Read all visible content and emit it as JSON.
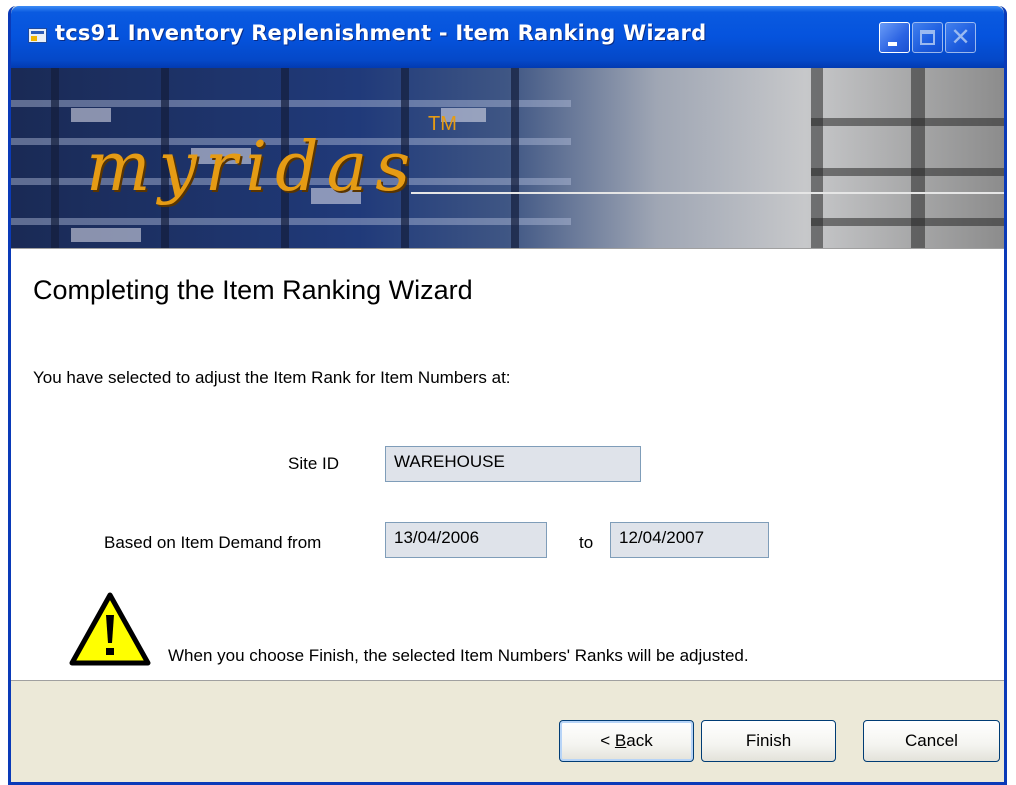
{
  "window": {
    "title": "tcs91 Inventory Replenishment - Item Ranking Wizard"
  },
  "banner": {
    "logo_text": "myridas",
    "trademark": "TM"
  },
  "content": {
    "heading": "Completing the Item Ranking Wizard",
    "intro": "You have selected to adjust the Item Rank for Item Numbers at:",
    "site_id_label": "Site ID",
    "site_id_value": "WAREHOUSE",
    "demand_label": "Based on Item Demand from",
    "from_date": "13/04/2006",
    "to_label": "to",
    "to_date": "12/04/2007",
    "warning_text": "When you choose Finish, the selected Item Numbers' Ranks will be adjusted."
  },
  "buttons": {
    "back_prefix": "< ",
    "back_mnemonic": "B",
    "back_rest": "ack",
    "finish": "Finish",
    "cancel": "Cancel"
  },
  "colors": {
    "titlebar": "#0553dd",
    "logo": "#e59b14",
    "field_bg": "#dfe3ea",
    "dialog_bg": "#ece9d8"
  },
  "icons": {
    "title": "app-window-icon",
    "warning": "warning-triangle-icon"
  }
}
